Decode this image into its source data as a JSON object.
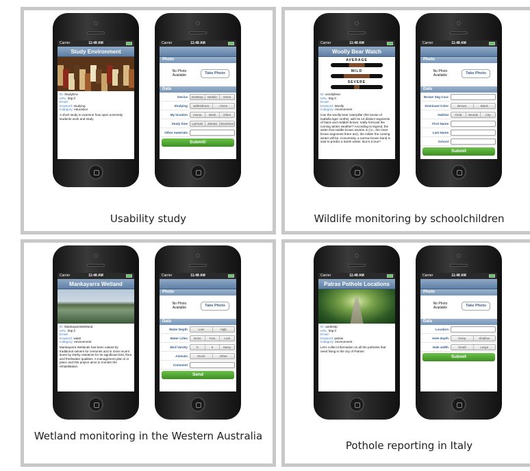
{
  "panels": [
    {
      "caption": "Usability study",
      "detail": {
        "status": {
          "carrier": "Carrier",
          "time": "11:48 AM"
        },
        "title": "Study Environment",
        "lines": [
          {
            "key": "ID:",
            "value": "StudyEnv"
          },
          {
            "key": "URL:",
            "value": "http://"
          },
          {
            "key": "Email:",
            "value": ""
          },
          {
            "key": "Keyword:",
            "value": "studying"
          },
          {
            "key": "Category:",
            "value": "education"
          }
        ],
        "description": "A short study to examine how open university students work and study"
      },
      "form": {
        "status": {
          "carrier": "Carrier",
          "time": "11:48 AM"
        },
        "photo_header": "Photo",
        "no_photo": "No Photo Available",
        "take_photo": "Take Photo",
        "data_header": "Data",
        "rows": [
          {
            "label": "Device",
            "options": [
              "Desktop",
              "Mobile",
              "None"
            ]
          },
          {
            "label": "Studying",
            "options": [
              "WithOthers",
              "Alone"
            ]
          },
          {
            "label": "My location",
            "options": [
              "Home",
              "Work",
              "Other"
            ]
          },
          {
            "label": "Study time",
            "options": [
              "UpTo30",
              "30to60",
              "60orMore"
            ]
          },
          {
            "label": "Other materials",
            "options": []
          }
        ],
        "submit": "Submit!"
      }
    },
    {
      "caption": "Wildlife monitoring by schoolchildren",
      "detail": {
        "status": {
          "carrier": "Carrier",
          "time": "11:48 AM"
        },
        "title": "Woolly Bear Watch",
        "image_labels": [
          "AVERAGE",
          "MILD",
          "SEVERE"
        ],
        "lines": [
          {
            "key": "ID:",
            "value": "woollybear"
          },
          {
            "key": "URL:",
            "value": "http://"
          },
          {
            "key": "Email:",
            "value": ""
          },
          {
            "key": "Keyword:",
            "value": "Woolly"
          },
          {
            "key": "Category:",
            "value": "environment"
          }
        ],
        "description": "Can the woolly bear caterpillar (the larvae of Isabella tiger moths), with its 13 distinct segments of black and reddish-brown, really forecast the coming winter weather? According to legend, the wider that middle brown section is (i.e., the more brown segments there are), the milder the coming winter will be. Conversely, a narrow brown band is said to predict a harsh winter. But is it true?"
      },
      "form": {
        "status": {
          "carrier": "Carrier",
          "time": "11:48 AM"
        },
        "photo_header": "Photo",
        "no_photo": "No Photo Available",
        "take_photo": "Take Photo",
        "data_header": "Data",
        "rows": [
          {
            "label": "Brown Seg Cour",
            "options": []
          },
          {
            "label": "Dominant Color",
            "options": [
              "Brown",
              "Black"
            ]
          },
          {
            "label": "Habitat",
            "options": [
              "Field",
              "Woods",
              "City"
            ]
          },
          {
            "label": "First Name",
            "options": []
          },
          {
            "label": "Last Name",
            "options": []
          },
          {
            "label": "School",
            "options": []
          }
        ],
        "submit": "Submit"
      }
    },
    {
      "caption": "Wetland monitoring in the Western Australia",
      "detail": {
        "status": {
          "carrier": "Carrier",
          "time": "11:48 AM"
        },
        "title": "Mankayarra Wetland",
        "lines": [
          {
            "key": "ID:",
            "value": "MankayarraWetland"
          },
          {
            "key": "URL:",
            "value": "http://"
          },
          {
            "key": "Email:",
            "value": ""
          },
          {
            "key": "Keyword:",
            "value": "water"
          },
          {
            "key": "Category:",
            "value": "environment"
          }
        ],
        "description": "Mankayarra Wetlands has been valued by traditional owners for centuries and in more recent times by Derby residents for its significant bird, flora and freshwater qualities. A management plan is in place and this project aims to monitor the rehabilitation."
      },
      "form": {
        "status": {
          "carrier": "Carrier",
          "time": "11:48 AM"
        },
        "photo_header": "Photo",
        "no_photo": "No Photo Available",
        "take_photo": "Take Photo",
        "data_header": "Data",
        "rows": [
          {
            "label": "Water Depth",
            "options": [
              "Low",
              "High"
            ]
          },
          {
            "label": "Water Lilies",
            "options": [
              "None",
              "Few",
              "Lots"
            ]
          },
          {
            "label": "Bird Variety",
            "options": [
              "0",
              "5",
              "Many"
            ]
          },
          {
            "label": "Animals",
            "options": [
              "Stock",
              "Other"
            ]
          },
          {
            "label": "Comment",
            "options": []
          }
        ],
        "submit": "Send"
      }
    },
    {
      "caption": "Pothole reporting in Italy",
      "detail": {
        "status": {
          "carrier": "Carrier",
          "time": "11:48 AM"
        },
        "title": "Patras Pothole Locations",
        "lines": [
          {
            "key": "ID:",
            "value": "andtestp"
          },
          {
            "key": "URL:",
            "value": "http://"
          },
          {
            "key": "Email:",
            "value": ""
          },
          {
            "key": "Keyword:",
            "value": "patras"
          },
          {
            "key": "Category:",
            "value": "environment"
          }
        ],
        "description": "Let's collect information on all the potholes that need fixing in the city of Patras!"
      },
      "form": {
        "status": {
          "carrier": "Carrier",
          "time": "11:48 AM"
        },
        "photo_header": "Photo",
        "no_photo": "No Photo Available",
        "take_photo": "Take Photo",
        "data_header": "Data",
        "rows": [
          {
            "label": "Location",
            "options": []
          },
          {
            "label": "Hole depth",
            "options": [
              "Deep",
              "Shallow"
            ]
          },
          {
            "label": "Hole width",
            "options": [
              "Small",
              "Large"
            ]
          }
        ],
        "submit": "Submit"
      }
    }
  ]
}
